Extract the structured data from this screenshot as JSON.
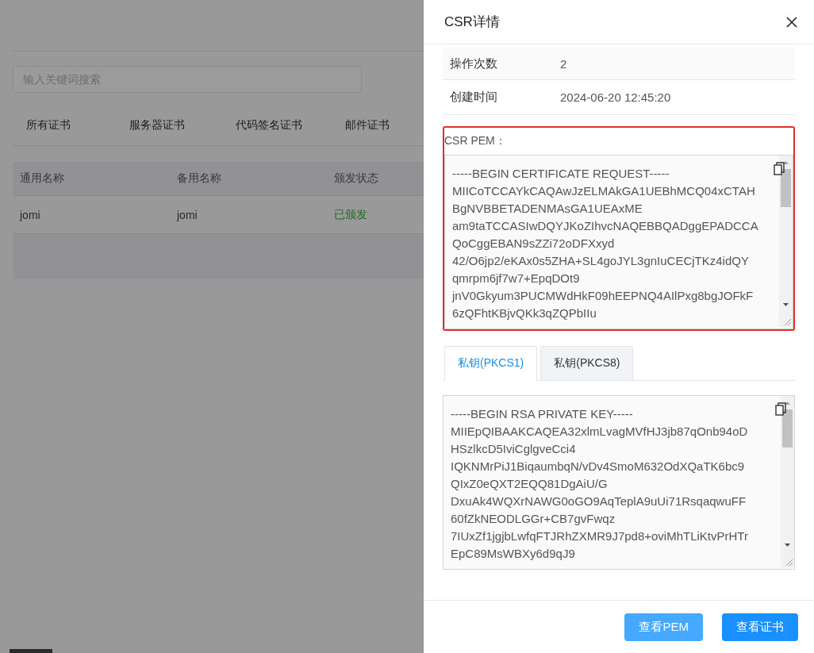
{
  "page": {
    "search": {
      "placeholder": "输入关键词搜索"
    },
    "tabs": [
      {
        "label": "所有证书",
        "selected": false
      },
      {
        "label": "服务器证书",
        "selected": false
      },
      {
        "label": "代码签名证书",
        "selected": false
      },
      {
        "label": "邮件证书",
        "selected": false
      }
    ],
    "table": {
      "columns": [
        "通用名称",
        "备用名称",
        "颁发状态"
      ],
      "rows": [
        {
          "cells": [
            "jomi",
            "jomi"
          ],
          "status": {
            "text": "已颁发",
            "color": "#1e6b1e"
          }
        }
      ]
    }
  },
  "drawer": {
    "title": "CSR详情",
    "details": [
      {
        "label": "操作次数",
        "value": "2"
      },
      {
        "label": "创建时间",
        "value": "2024-06-20 12:45:20"
      }
    ],
    "csr": {
      "label": "CSR PEM：",
      "highlighted": true,
      "lines": [
        "-----BEGIN CERTIFICATE REQUEST-----",
        "MIICoTCCAYkCAQAwJzELMAkGA1UEBhMCQ04xCTAH",
        "BgNVBBETADENMAsGA1UEAxME",
        "am9taTCCASIwDQYJKoZIhvcNAQEBBQADggEPADCCA",
        "QoCggEBAN9sZZi72oDFXxyd",
        "42/O6jp2/eKAx0s5ZHA+SL4goJYL3gnIuCECjTKz4idQY",
        "qmrpm6jf7w7+EpqDOt9",
        "jnV0Gkyum3PUCMWdHkF09hEEPNQ4AIlPxg8bgJOFkF",
        "6zQFhtKBjvQKk3qZQPbIIu"
      ]
    },
    "key_tabs": [
      {
        "label": "私钥(PKCS1)",
        "selected": true
      },
      {
        "label": "私钥(PKCS8)",
        "selected": false
      }
    ],
    "key_lines": [
      "-----BEGIN RSA PRIVATE KEY-----",
      "MIIEpQIBAAKCAQEA32xlmLvagMVfHJ3jb87qOnb94oD",
      "HSzlkcD5IviCglgveCci4",
      "IQKNMrPiJ1BiqaumbqN/vDv4SmoM632OdXQaTK6bc9",
      "QIxZ0eQXT2EQQ81DgAiU/G",
      "DxuAk4WQXrNAWG0oGO9AqTeplA9uUi71RsqaqwuFF",
      "60fZkNEODLGGr+CB7gvFwqz",
      "7IUxZf1jgjbLwfqFTJRhZXMR9J7pd8+oviMhTLiKtvPrHTr",
      "EpC89MsWBXy6d9qJ9"
    ],
    "buttons": [
      {
        "label": "查看PEM",
        "kind": "secondary"
      },
      {
        "label": "查看证书",
        "kind": "primary"
      }
    ]
  }
}
